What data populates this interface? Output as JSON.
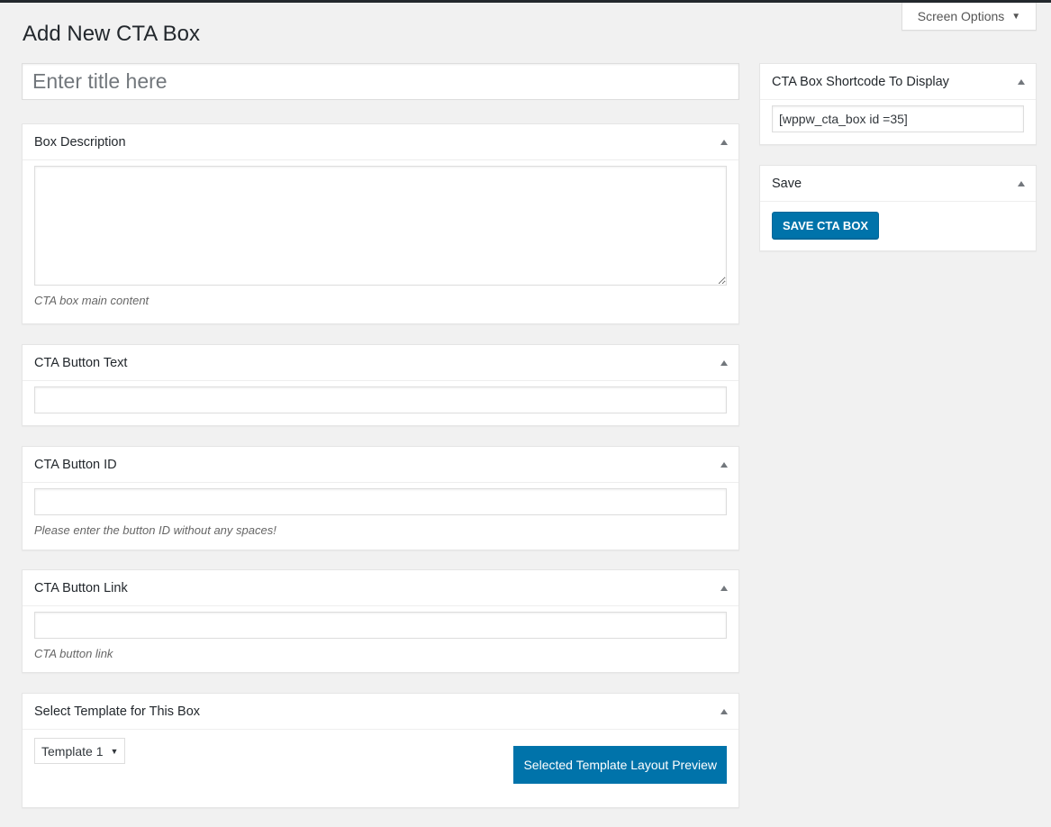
{
  "header": {
    "screen_options_label": "Screen Options",
    "page_title": "Add New CTA Box"
  },
  "title_input": {
    "placeholder": "Enter title here",
    "value": ""
  },
  "main": {
    "box_description": {
      "title": "Box Description",
      "value": "",
      "help": "CTA box main content"
    },
    "button_text": {
      "title": "CTA Button Text",
      "value": ""
    },
    "button_id": {
      "title": "CTA Button ID",
      "value": "",
      "help": "Please enter the button ID without any spaces!"
    },
    "button_link": {
      "title": "CTA Button Link",
      "value": "",
      "help": "CTA button link"
    },
    "template": {
      "title": "Select Template for This Box",
      "selected": "Template 1",
      "preview_button": "Selected Template Layout Preview"
    }
  },
  "sidebar": {
    "shortcode": {
      "title": "CTA Box Shortcode To Display",
      "value": "[wppw_cta_box id =35]"
    },
    "save": {
      "title": "Save",
      "button": "SAVE CTA BOX"
    }
  },
  "colors": {
    "primary": "#0073aa",
    "background": "#f1f1f1"
  }
}
